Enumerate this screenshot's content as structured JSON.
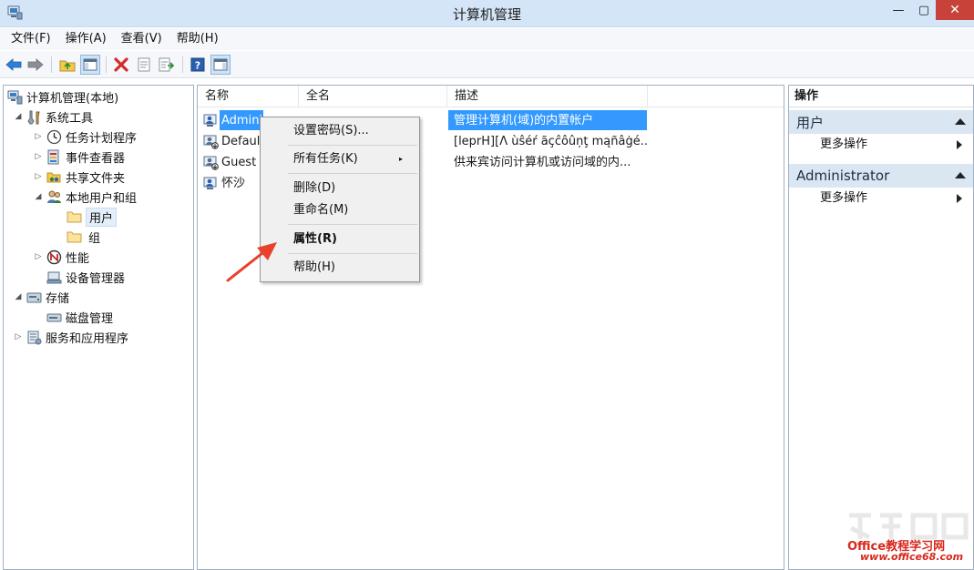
{
  "window": {
    "title": "计算机管理",
    "minimize_glyph": "—",
    "maximize_glyph": "▢",
    "close_glyph": "✕"
  },
  "menubar": {
    "items": [
      "文件(F)",
      "操作(A)",
      "查看(V)",
      "帮助(H)"
    ]
  },
  "toolbar": {
    "icons": [
      "back-icon",
      "forward-icon",
      "up-folder-icon",
      "show-hide-tree-icon",
      "delete-icon",
      "properties-icon",
      "export-list-icon",
      "help-icon",
      "show-hide-action-pane-icon"
    ]
  },
  "tree": {
    "nodes": [
      {
        "label": "计算机管理(本地)",
        "icon": "computer-management-icon"
      },
      {
        "label": "系统工具",
        "icon": "tools-icon"
      },
      {
        "label": "任务计划程序",
        "icon": "clock-icon"
      },
      {
        "label": "事件查看器",
        "icon": "event-viewer-icon"
      },
      {
        "label": "共享文件夹",
        "icon": "shared-folder-icon"
      },
      {
        "label": "本地用户和组",
        "icon": "users-icon"
      },
      {
        "label": "用户",
        "icon": "folder-icon"
      },
      {
        "label": "组",
        "icon": "folder-icon"
      },
      {
        "label": "性能",
        "icon": "performance-icon"
      },
      {
        "label": "设备管理器",
        "icon": "device-manager-icon"
      },
      {
        "label": "存储",
        "icon": "storage-icon"
      },
      {
        "label": "磁盘管理",
        "icon": "disk-icon"
      },
      {
        "label": "服务和应用程序",
        "icon": "services-icon"
      }
    ]
  },
  "list": {
    "columns": [
      "名称",
      "全名",
      "描述"
    ],
    "rows": [
      {
        "name": "Admini",
        "fullname": "",
        "description": "管理计算机(域)的内置帐户",
        "selected": true
      },
      {
        "name": "Defaul",
        "fullname": "",
        "description": "[leprH][Λ ùŝéŕ ãçĉôûņţ mąñâġé..."
      },
      {
        "name": "Guest",
        "fullname": "",
        "description": "供来宾访问计算机或访问域的内..."
      },
      {
        "name": "怀沙",
        "fullname": "",
        "description": ""
      }
    ]
  },
  "context_menu": {
    "items": [
      {
        "label": "设置密码(S)..."
      },
      {
        "label": "所有任务(K)",
        "submenu": "▸"
      },
      {
        "label": "删除(D)"
      },
      {
        "label": "重命名(M)"
      },
      {
        "label": "属性(R)",
        "bold": true
      },
      {
        "label": "帮助(H)"
      }
    ]
  },
  "actions": {
    "title": "操作",
    "sections": [
      {
        "label": "用户",
        "items": [
          "更多操作"
        ]
      },
      {
        "label": "Administrator",
        "items": [
          "更多操作"
        ]
      }
    ]
  },
  "watermark": {
    "text": "Office教程学习网",
    "url": "www.office68.com"
  },
  "colors": {
    "selection": "#3399ff",
    "titlebar": "#d4e5f7",
    "close_button": "#c7433a",
    "annotation_arrow": "#e8412c"
  }
}
